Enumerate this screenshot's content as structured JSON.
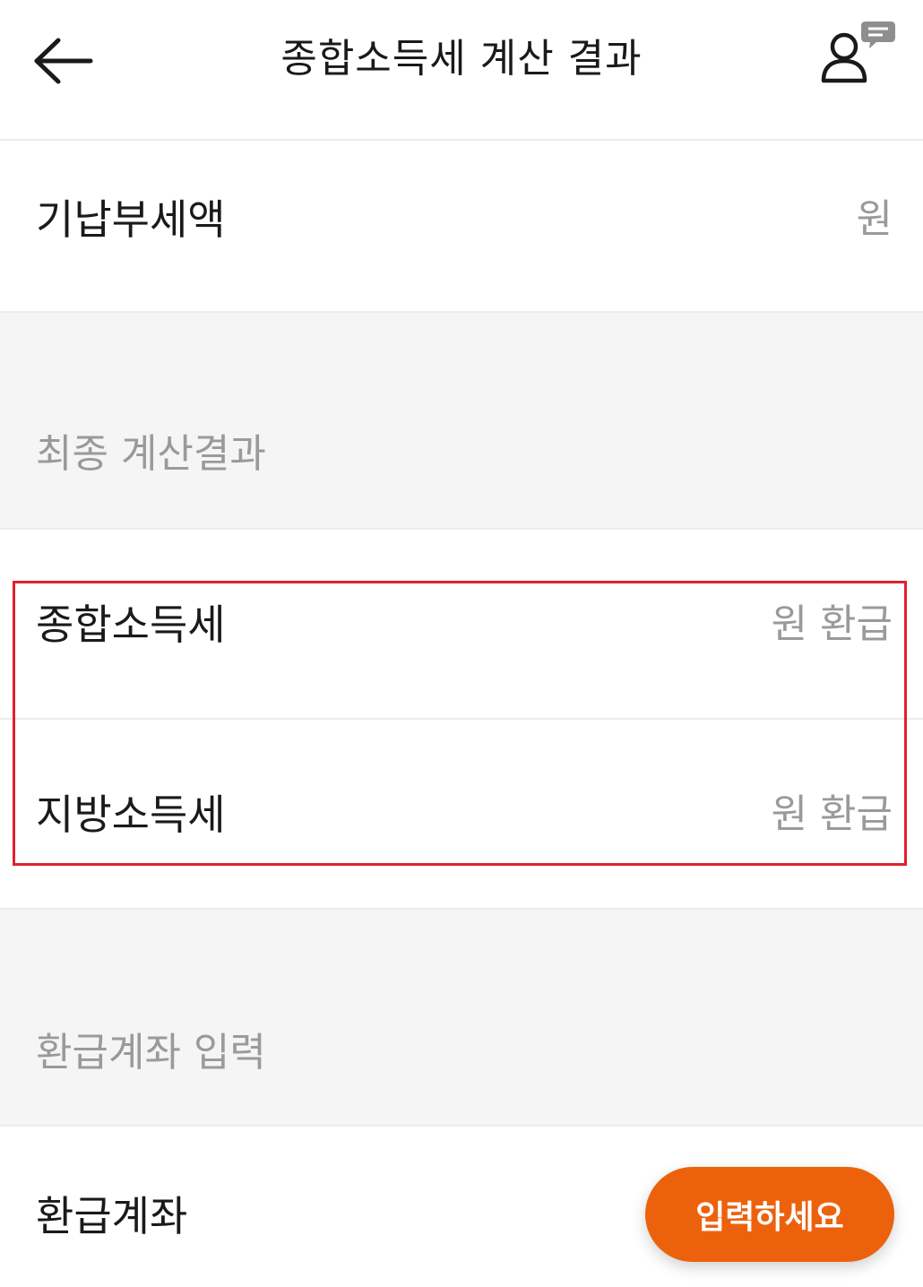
{
  "header": {
    "title": "종합소득세 계산 결과",
    "back_icon": "arrow-left-icon",
    "profile_icon": "user-chat-icon"
  },
  "prepaid_tax": {
    "label": "기납부세액",
    "value": "원"
  },
  "final_section": {
    "title": "최종 계산결과"
  },
  "results": [
    {
      "label": "종합소득세",
      "value": "원 환급"
    },
    {
      "label": "지방소득세",
      "value": "원 환급"
    }
  ],
  "refund_section": {
    "title": "환급계좌 입력"
  },
  "refund_account": {
    "label": "환급계좌",
    "button_label": "입력하세요"
  },
  "colors": {
    "accent": "#ec620c",
    "highlight": "#e0202e",
    "muted_text": "#9a9a9a",
    "section_bg": "#f5f5f5"
  }
}
